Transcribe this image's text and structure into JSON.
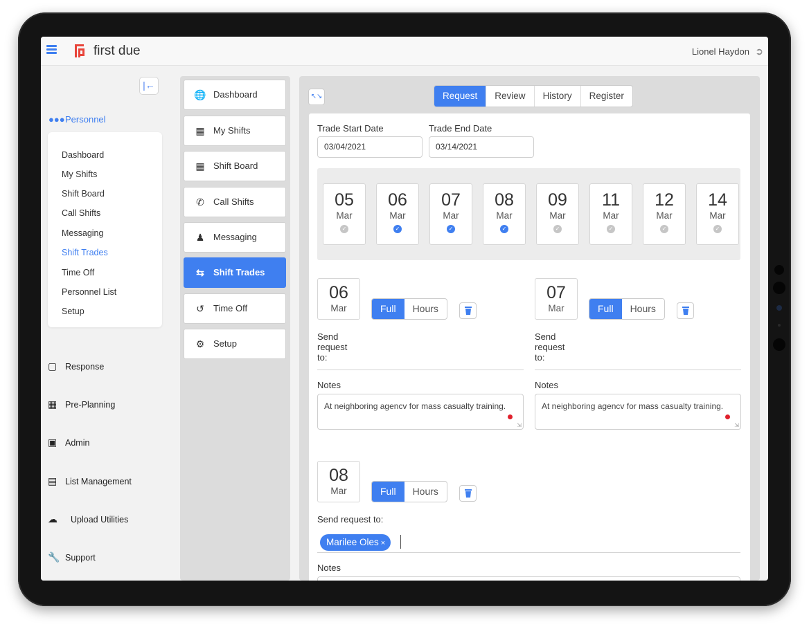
{
  "app": {
    "brand": "first due",
    "user": "Lionel Haydon"
  },
  "sidebar": {
    "collapse_icon": "collapse-left-icon",
    "section": "Personnel",
    "submenu": [
      {
        "label": "Dashboard",
        "active": false
      },
      {
        "label": "My Shifts",
        "active": false
      },
      {
        "label": "Shift Board",
        "active": false
      },
      {
        "label": "Call Shifts",
        "active": false
      },
      {
        "label": "Messaging",
        "active": false
      },
      {
        "label": "Shift Trades",
        "active": true
      },
      {
        "label": "Time Off",
        "active": false
      },
      {
        "label": "Personnel List",
        "active": false
      },
      {
        "label": "Setup",
        "active": false
      }
    ],
    "links": [
      {
        "label": "Response",
        "icon": "response-icon"
      },
      {
        "label": "Pre-Planning",
        "icon": "map-icon"
      },
      {
        "label": "Admin",
        "icon": "folder-gear-icon"
      },
      {
        "label": "List Management",
        "icon": "list-gear-icon"
      },
      {
        "label": "Upload Utilities",
        "icon": "cloud-upload-icon"
      },
      {
        "label": "Support",
        "icon": "wrench-icon"
      }
    ]
  },
  "midnav": [
    {
      "label": "Dashboard",
      "icon": "globe-icon",
      "active": false
    },
    {
      "label": "My Shifts",
      "icon": "calendar-icon",
      "active": false
    },
    {
      "label": "Shift Board",
      "icon": "calendar-icon",
      "active": false
    },
    {
      "label": "Call Shifts",
      "icon": "phone-icon",
      "active": false
    },
    {
      "label": "Messaging",
      "icon": "users-icon",
      "active": false
    },
    {
      "label": "Shift Trades",
      "icon": "exchange-icon",
      "active": true
    },
    {
      "label": "Time Off",
      "icon": "history-icon",
      "active": false
    },
    {
      "label": "Setup",
      "icon": "gear-icon",
      "active": false
    }
  ],
  "tabs": [
    {
      "label": "Request",
      "active": true
    },
    {
      "label": "Review",
      "active": false
    },
    {
      "label": "History",
      "active": false
    },
    {
      "label": "Register",
      "active": false
    }
  ],
  "form": {
    "start_label": "Trade Start Date",
    "start_value": "03/04/2021",
    "end_label": "Trade End Date",
    "end_value": "03/14/2021"
  },
  "days": [
    {
      "day": "05",
      "month": "Mar",
      "selected": false
    },
    {
      "day": "06",
      "month": "Mar",
      "selected": true
    },
    {
      "day": "07",
      "month": "Mar",
      "selected": true
    },
    {
      "day": "08",
      "month": "Mar",
      "selected": true
    },
    {
      "day": "09",
      "month": "Mar",
      "selected": false
    },
    {
      "day": "11",
      "month": "Mar",
      "selected": false
    },
    {
      "day": "12",
      "month": "Mar",
      "selected": false
    },
    {
      "day": "14",
      "month": "Mar",
      "selected": false
    }
  ],
  "trades": [
    {
      "day": "06",
      "month": "Mar",
      "full": "Full",
      "hours": "Hours",
      "send_label": "Send request to:",
      "notes_label": "Notes",
      "notes": "At neighboring agencv for mass casualty training."
    },
    {
      "day": "07",
      "month": "Mar",
      "full": "Full",
      "hours": "Hours",
      "send_label": "Send request to:",
      "notes_label": "Notes",
      "notes": "At neighboring agencv for mass casualty training."
    },
    {
      "day": "08",
      "month": "Mar",
      "full": "Full",
      "hours": "Hours",
      "send_label": "Send request to:",
      "notes_label": "Notes",
      "recipient": "Marilee Oles",
      "remove": "×"
    }
  ],
  "colors": {
    "accent": "#3f7ff0",
    "required": "#e0202c"
  }
}
